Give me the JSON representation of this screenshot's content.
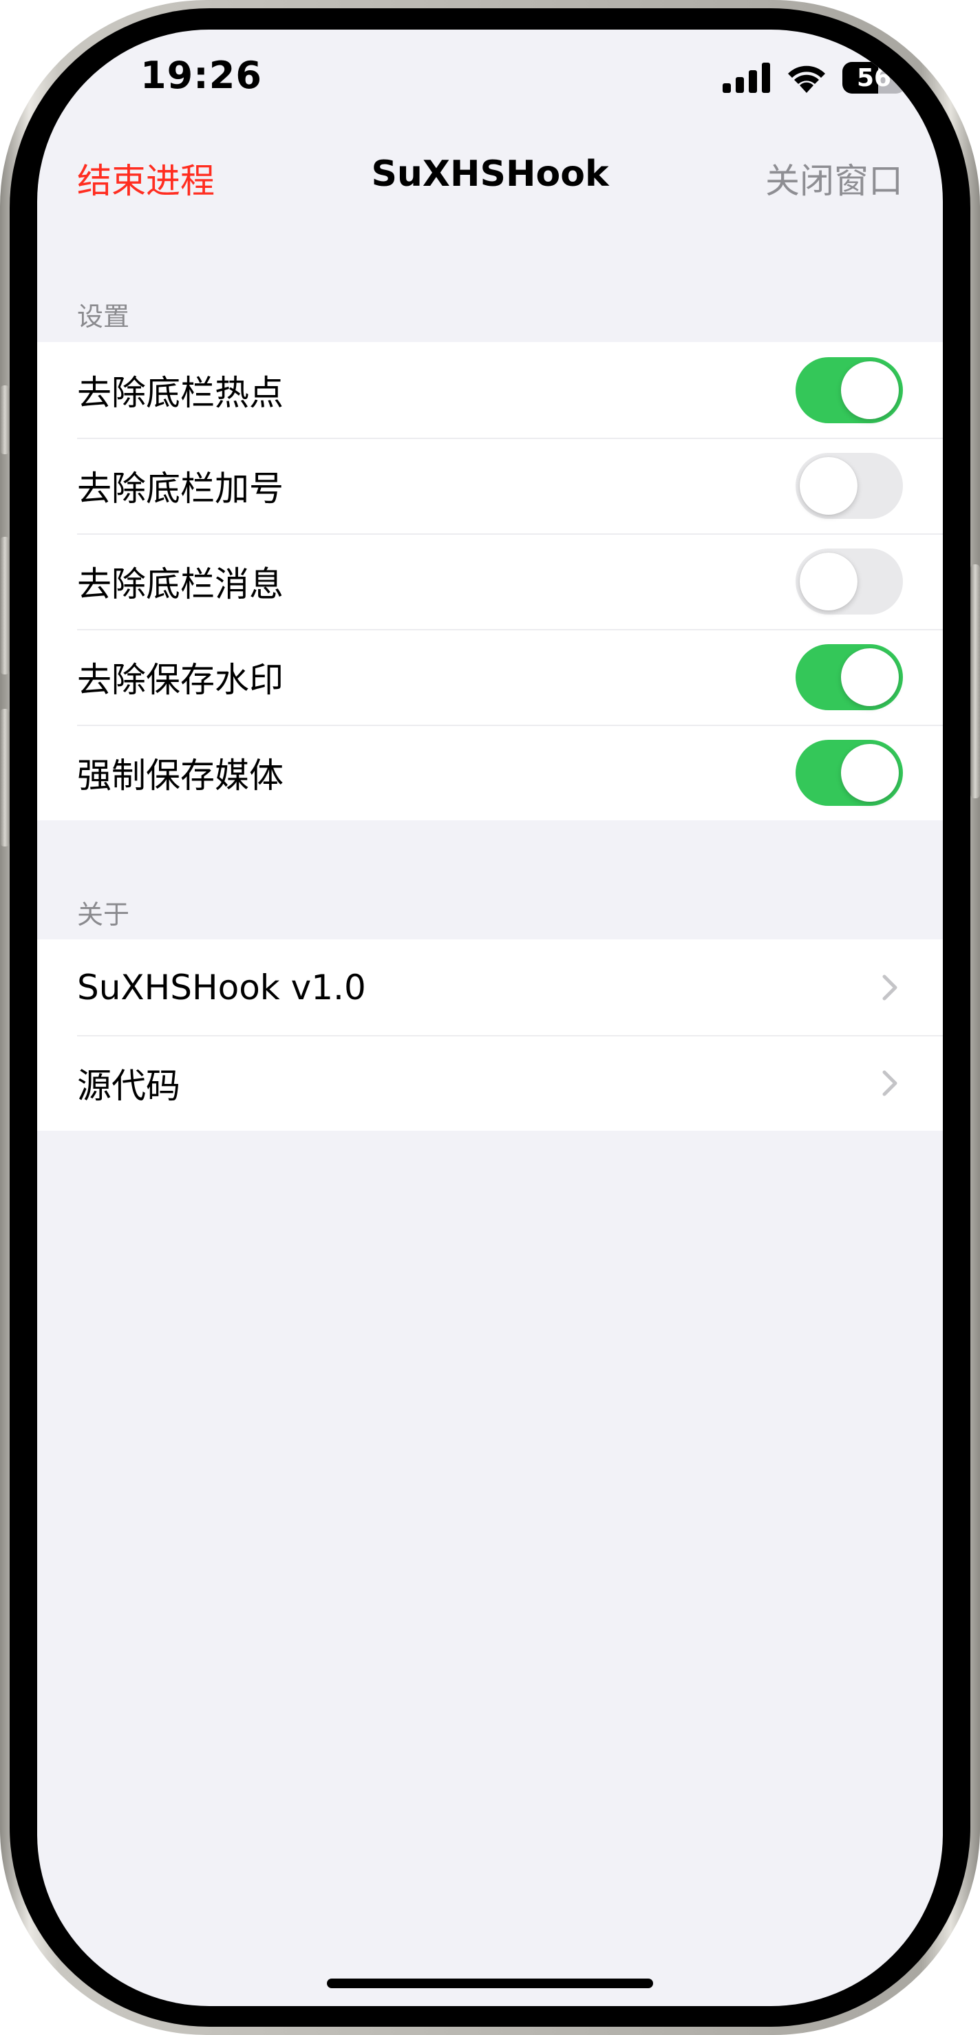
{
  "status_bar": {
    "time": "19:26",
    "battery_level": "56"
  },
  "nav": {
    "left_label": "结束进程",
    "title": "SuXHSHook",
    "right_label": "关闭窗口"
  },
  "settings": {
    "header": "设置",
    "items": [
      {
        "label": "去除底栏热点",
        "on": true
      },
      {
        "label": "去除底栏加号",
        "on": false
      },
      {
        "label": "去除底栏消息",
        "on": false
      },
      {
        "label": "去除保存水印",
        "on": true
      },
      {
        "label": "强制保存媒体",
        "on": true
      }
    ]
  },
  "about": {
    "header": "关于",
    "items": [
      {
        "label": "SuXHSHook v1.0"
      },
      {
        "label": "源代码"
      }
    ]
  },
  "colors": {
    "toggle_on": "#34c759",
    "toggle_off": "#e9e9eb",
    "destructive": "#ff2d20",
    "secondary": "#8e8e93",
    "background": "#f2f2f7"
  }
}
